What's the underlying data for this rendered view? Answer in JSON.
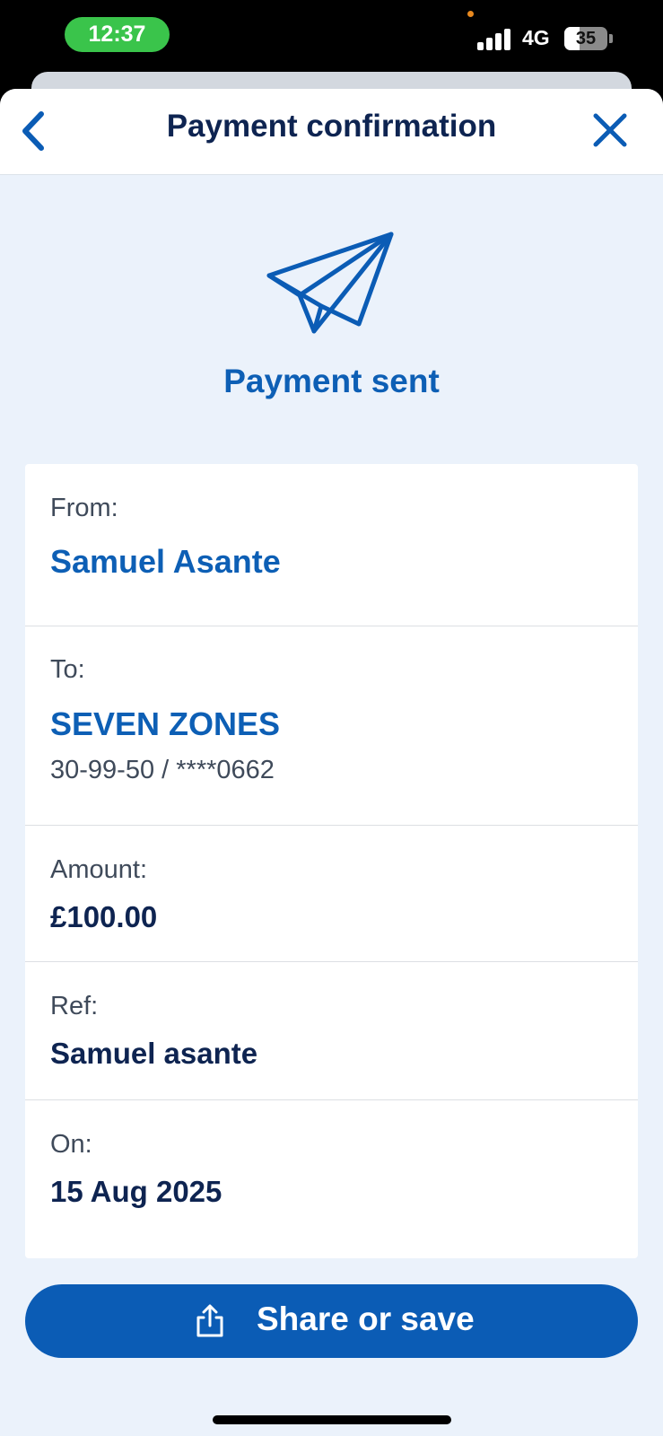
{
  "status_bar": {
    "time": "12:37",
    "network": "4G",
    "battery": "35",
    "battery_level": 0.35,
    "signal_bars": 4
  },
  "header": {
    "title": "Payment confirmation",
    "back_icon": "chevron-left-icon",
    "close_icon": "close-icon"
  },
  "hero": {
    "icon": "paper-plane-icon",
    "title": "Payment sent"
  },
  "details": {
    "from": {
      "label": "From:",
      "name": "Samuel Asante"
    },
    "to": {
      "label": "To:",
      "name": "SEVEN ZONES",
      "account": "30-99-50 / ****0662"
    },
    "amount": {
      "label": "Amount:",
      "value": "£100.00"
    },
    "ref": {
      "label": "Ref:",
      "value": "Samuel asante"
    },
    "on": {
      "label": "On:",
      "value": "15 Aug 2025"
    }
  },
  "actions": {
    "share_label": "Share or save",
    "share_icon": "share-icon"
  },
  "colors": {
    "accent": "#0b5cb5",
    "heading": "#0e2451",
    "background": "#ebf2fb",
    "status_green": "#3ac44b"
  }
}
